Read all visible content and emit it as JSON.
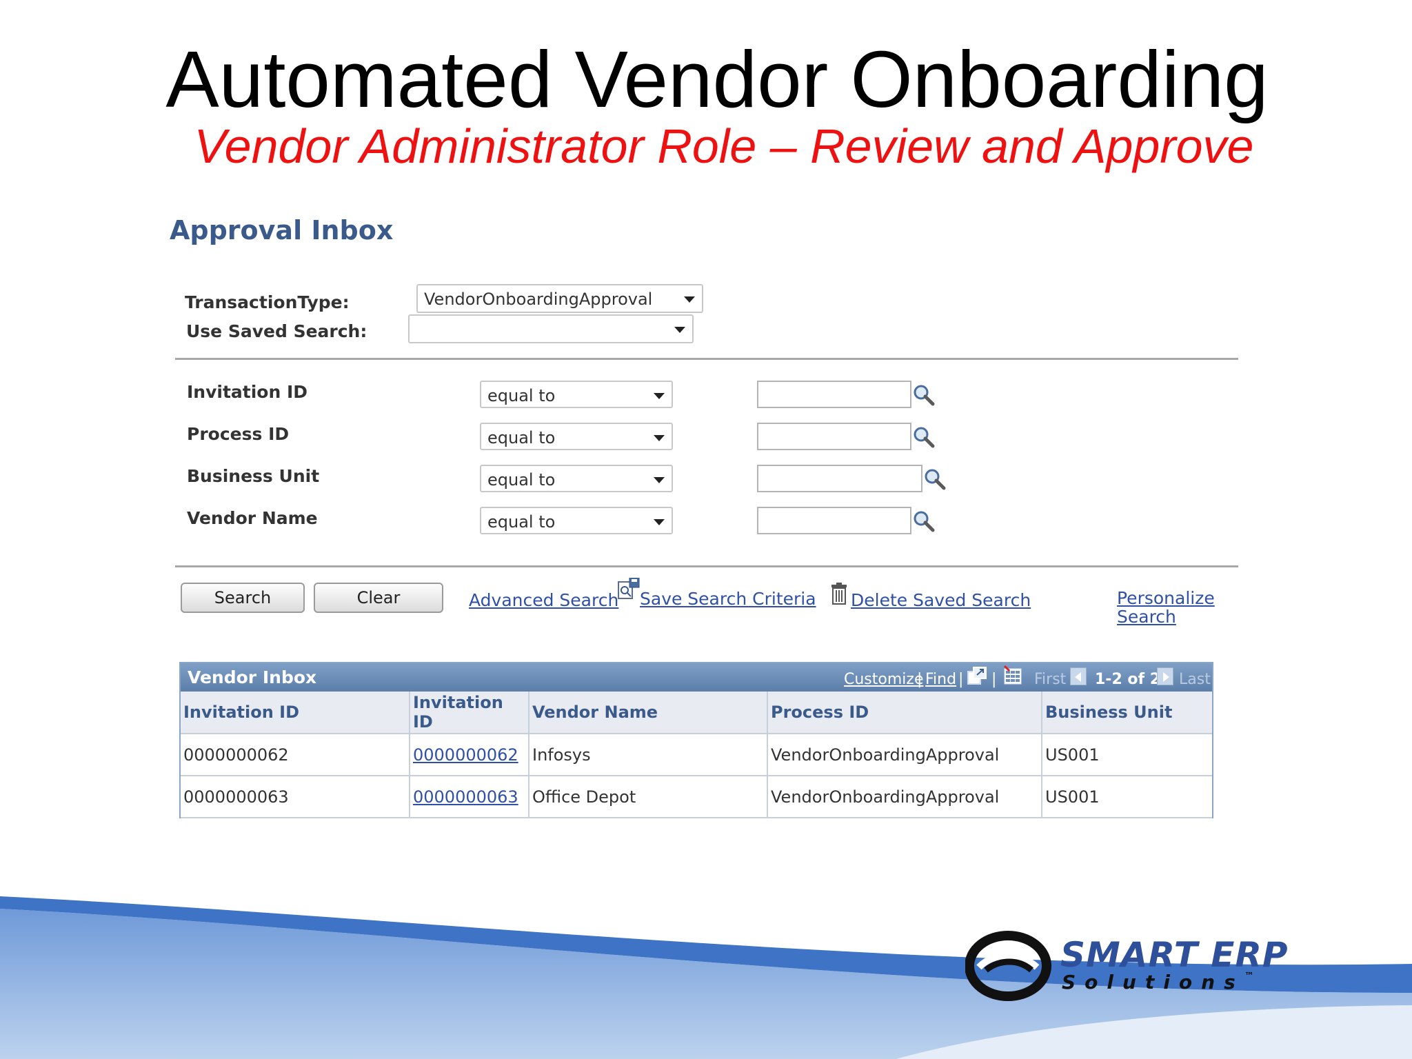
{
  "slide": {
    "title": "Automated Vendor Onboarding",
    "subtitle": "Vendor Administrator Role – Review and Approve"
  },
  "inbox": {
    "title": "Approval Inbox",
    "transaction_type_label": "TransactionType:",
    "transaction_type_value": "VendorOnboardingApproval",
    "saved_search_label": "Use Saved Search:",
    "saved_search_value": ""
  },
  "criteria": [
    {
      "label": "Invitation ID",
      "operator": "equal to",
      "value": ""
    },
    {
      "label": "Process ID",
      "operator": "equal to",
      "value": ""
    },
    {
      "label": "Business Unit",
      "operator": "equal to",
      "value": ""
    },
    {
      "label": "Vendor Name",
      "operator": "equal to",
      "value": ""
    }
  ],
  "actions": {
    "search": "Search",
    "clear": "Clear",
    "advanced_search": "Advanced Search",
    "save_search_criteria": "Save Search Criteria",
    "delete_saved_search": "Delete Saved Search",
    "personalize_line1": "Personalize",
    "personalize_line2": "Search"
  },
  "grid": {
    "title": "Vendor Inbox",
    "customize": "Customize",
    "find": "Find",
    "sep": "|",
    "first": "First",
    "range": "1-2 of 2",
    "last": "Last",
    "columns": [
      "Invitation ID",
      "Invitation ID",
      "Vendor Name",
      "Process ID",
      "Business Unit"
    ],
    "rows": [
      [
        "0000000062",
        "0000000062",
        "Infosys",
        "VendorOnboardingApproval",
        "US001"
      ],
      [
        "0000000063",
        "0000000063",
        "Office Depot",
        "VendorOnboardingApproval",
        "US001"
      ]
    ]
  },
  "logo": {
    "line1": "SMART ERP",
    "line2": "Solutions",
    "trademark": "™"
  },
  "colors": {
    "subtitle": "#ee1111",
    "header_text": "#3a5a8c",
    "link": "#3050a8",
    "grid_header": "#5b7eaa",
    "footer_blue": "#3f73c5"
  },
  "icons": [
    "magnifier-lookup-icon",
    "save-search-icon",
    "trash-icon",
    "zoom-grid-icon",
    "download-spreadsheet-icon"
  ]
}
